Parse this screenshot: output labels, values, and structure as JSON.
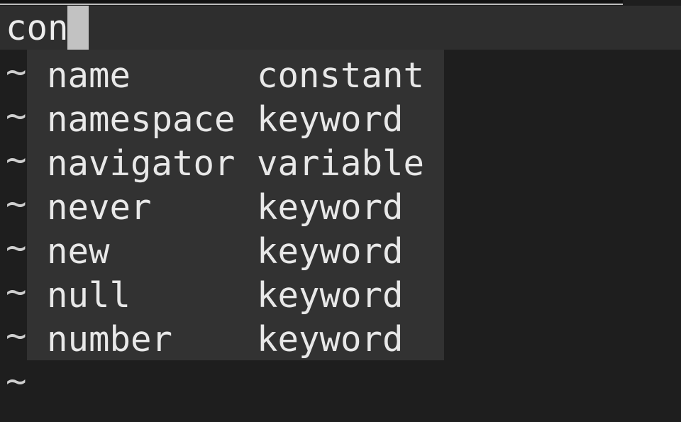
{
  "editor": {
    "current_line": "con",
    "empty_line_marker": "~"
  },
  "completion": {
    "items": [
      {
        "word": "name",
        "kind": "constant"
      },
      {
        "word": "namespace",
        "kind": "keyword"
      },
      {
        "word": "navigator",
        "kind": "variable"
      },
      {
        "word": "never",
        "kind": "keyword"
      },
      {
        "word": "new",
        "kind": "keyword"
      },
      {
        "word": "null",
        "kind": "keyword"
      },
      {
        "word": "number",
        "kind": "keyword"
      }
    ]
  },
  "colors": {
    "background": "#1e1e1e",
    "cursorline": "#2e2e2e",
    "popup": "#323232",
    "cursor": "#c2c2c2",
    "text": "#e6e6e6"
  }
}
